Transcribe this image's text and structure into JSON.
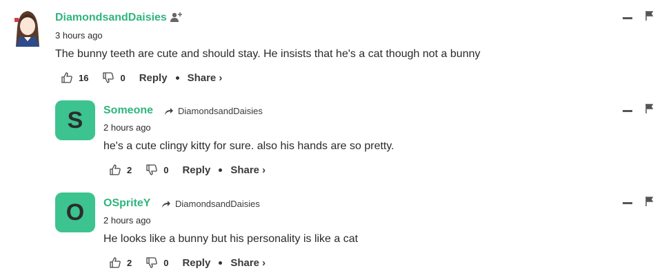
{
  "comments": [
    {
      "author": "DiamondsandDaisies",
      "time": "3 hours ago",
      "text": "The bunny teeth are cute and should stay. He insists that he's a cat though not a bunny",
      "likes": "16",
      "dislikes": "0",
      "reply_label": "Reply",
      "share_label": "Share ›"
    },
    {
      "avatar_letter": "S",
      "author": "Someone",
      "reply_to": "DiamondsandDaisies",
      "time": "2 hours ago",
      "text": "he's a cute clingy kitty for sure. also his hands are so pretty.",
      "likes": "2",
      "dislikes": "0",
      "reply_label": "Reply",
      "share_label": "Share ›"
    },
    {
      "avatar_letter": "O",
      "author": "OSpriteY",
      "reply_to": "DiamondsandDaisies",
      "time": "2 hours ago",
      "text": "He looks like a bunny but his personality is like a cat",
      "likes": "2",
      "dislikes": "0",
      "reply_label": "Reply",
      "share_label": "Share ›"
    }
  ],
  "colors": {
    "author": "#2fb57d",
    "avatar_bg": "#3cc38f"
  }
}
